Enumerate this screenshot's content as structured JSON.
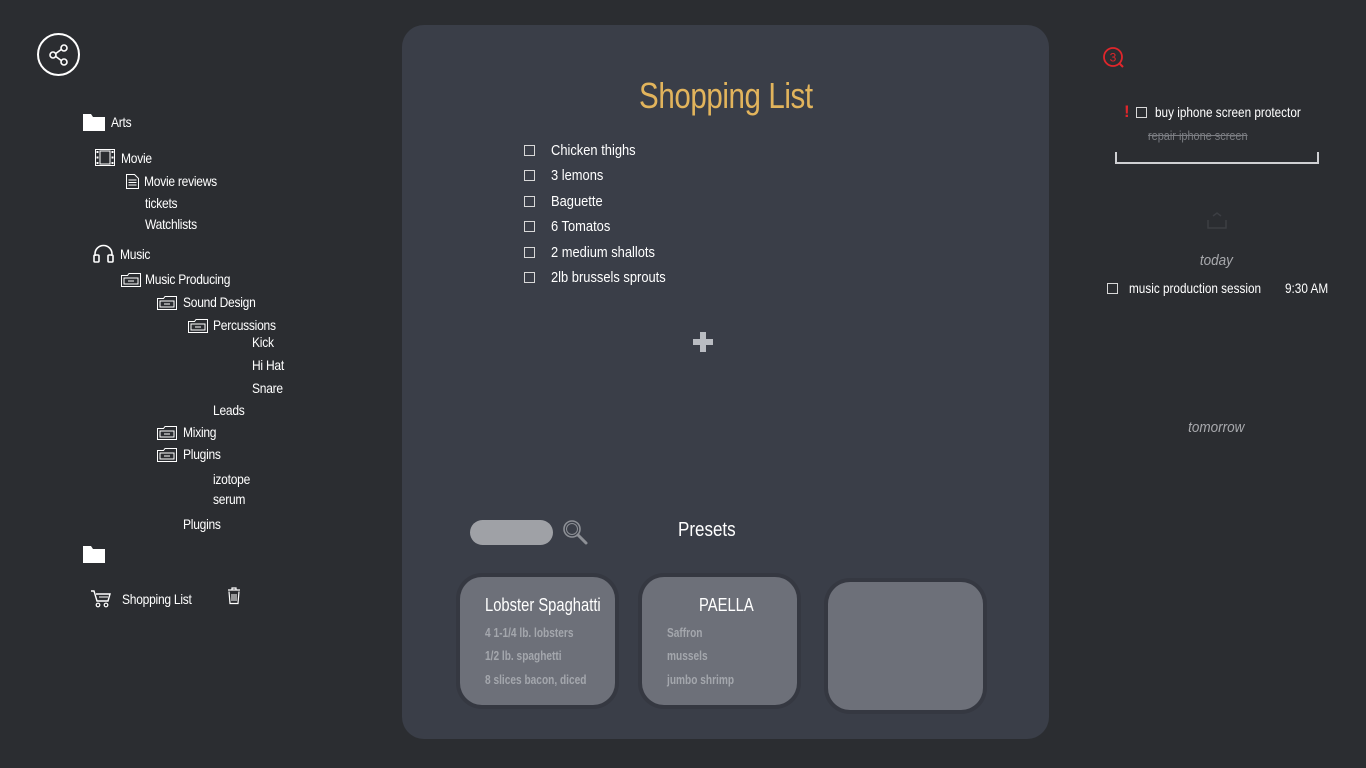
{
  "sidebar": {
    "tree": [
      {
        "label": "Arts",
        "icon": "folder-icon"
      },
      {
        "label": "Movie",
        "icon": "film-icon"
      },
      {
        "label": "Movie reviews",
        "icon": "document-icon"
      },
      {
        "label": "tickets",
        "icon": ""
      },
      {
        "label": "Watchlists",
        "icon": ""
      },
      {
        "label": "Music",
        "icon": "headphones-icon"
      },
      {
        "label": "Music Producing",
        "icon": "archive-folder-icon"
      },
      {
        "label": "Sound Design",
        "icon": "archive-folder-icon"
      },
      {
        "label": "Percussions",
        "icon": "archive-folder-icon"
      },
      {
        "label": "Kick",
        "icon": ""
      },
      {
        "label": "Hi Hat",
        "icon": ""
      },
      {
        "label": "Snare",
        "icon": ""
      },
      {
        "label": "Leads",
        "icon": ""
      },
      {
        "label": "Mixing",
        "icon": "archive-folder-icon"
      },
      {
        "label": "Plugins",
        "icon": "archive-folder-icon"
      },
      {
        "label": "izotope",
        "icon": ""
      },
      {
        "label": "serum",
        "icon": ""
      },
      {
        "label": "Plugins",
        "icon": ""
      }
    ],
    "shopping_list_label": "Shopping List"
  },
  "main": {
    "title": "Shopping List",
    "items": [
      "Chicken thighs",
      "3 lemons",
      "Baguette",
      "6 Tomatos",
      "2 medium shallots",
      "2lb brussels sprouts"
    ],
    "presets_label": "Presets",
    "presets": [
      {
        "title": "Lobster Spaghatti",
        "lines": [
          "4 1-1/4 lb. lobsters",
          "1/2 lb. spaghetti",
          "8 slices bacon, diced"
        ]
      },
      {
        "title": "PAELLA",
        "lines": [
          "Saffron",
          "mussels",
          "jumbo shrimp"
        ]
      },
      {
        "title": "",
        "lines": []
      }
    ]
  },
  "right": {
    "notification_count": "3",
    "priority_mark": "!",
    "todos": [
      {
        "label": "buy iphone screen protector",
        "done": false
      },
      {
        "label": "repair iphone screen",
        "done": true
      }
    ],
    "today_label": "today",
    "today_items": [
      {
        "label": "music production session",
        "time": "9:30 AM"
      }
    ],
    "tomorrow_label": "tomorrow"
  },
  "colors": {
    "accent": "#e2b45c",
    "background": "#2b2d31",
    "panel": "#3a3e48",
    "card": "#6d7079",
    "alert": "#e0262b"
  }
}
